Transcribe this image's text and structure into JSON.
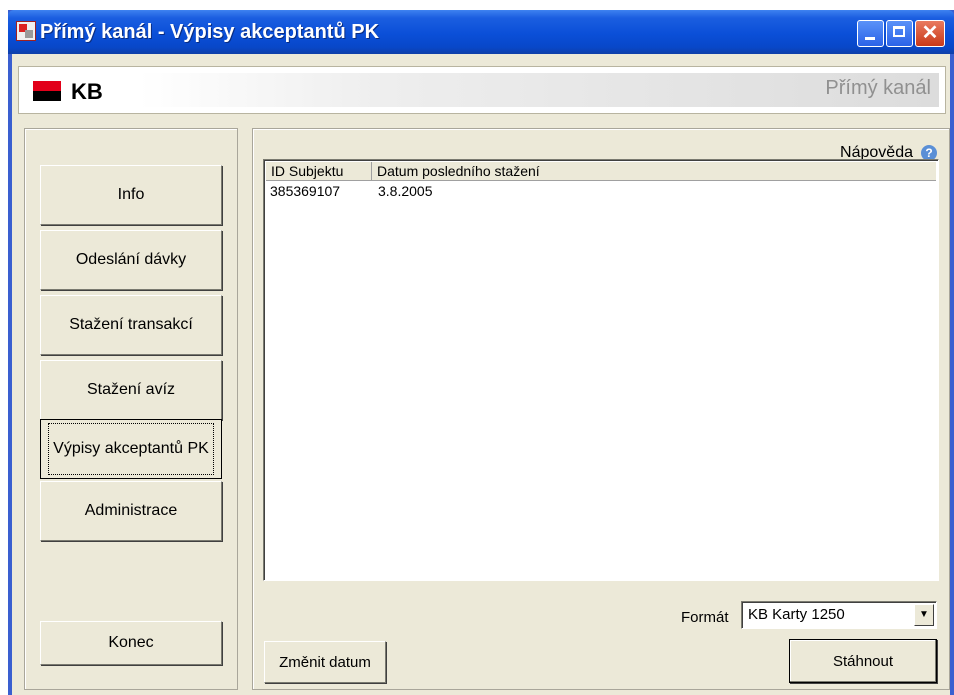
{
  "window": {
    "title": "Přímý kanál - Výpisy akceptantů PK"
  },
  "banner": {
    "logo_text": "KB",
    "app_name": "Přímý kanál"
  },
  "sidebar": {
    "items": [
      {
        "label": "Info"
      },
      {
        "label": "Odeslání dávky"
      },
      {
        "label": "Stažení transakcí"
      },
      {
        "label": "Stažení avíz"
      },
      {
        "label": "Výpisy akceptantů PK"
      },
      {
        "label": "Administrace"
      }
    ],
    "active_index": 4,
    "exit_label": "Konec"
  },
  "main": {
    "help_label": "Nápověda",
    "table": {
      "columns": [
        "ID Subjektu",
        "Datum posledního stažení"
      ],
      "rows": [
        [
          "385369107",
          "3.8.2005"
        ]
      ]
    },
    "format": {
      "label": "Formát",
      "value": "KB Karty 1250"
    },
    "change_date_label": "Změnit datum",
    "download_label": "Stáhnout"
  },
  "icons": [
    "app-icon",
    "minimize-icon",
    "maximize-icon",
    "close-icon",
    "help-icon",
    "dropdown-arrow-icon"
  ]
}
